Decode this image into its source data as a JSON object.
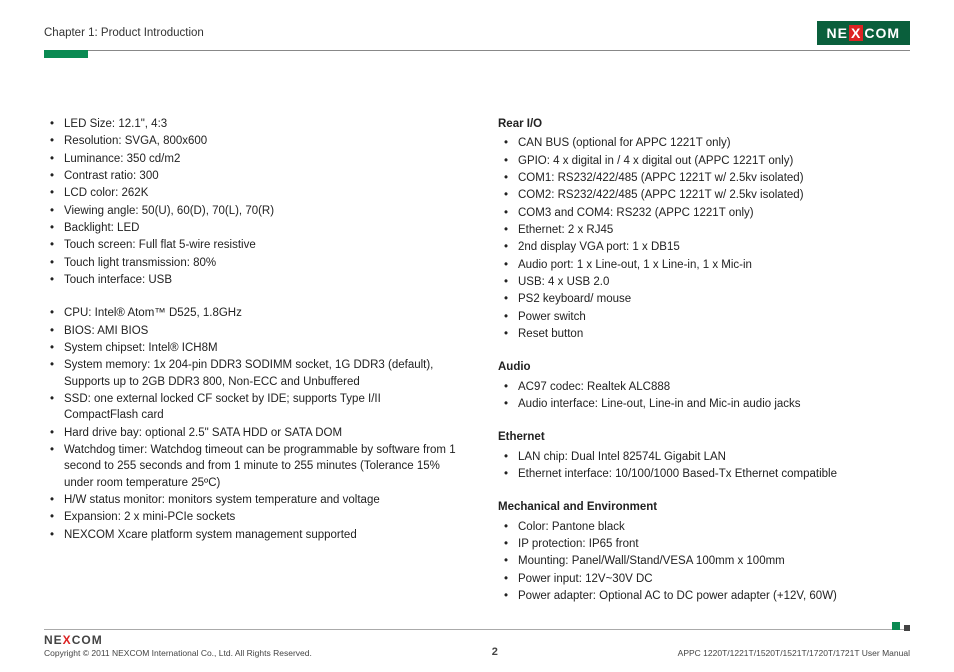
{
  "header": {
    "chapter": "Chapter 1: Product Introduction",
    "brand": "NEXCOM"
  },
  "left": {
    "block1": [
      "LED Size: 12.1\", 4:3",
      "Resolution: SVGA, 800x600",
      "Luminance: 350 cd/m2",
      "Contrast ratio: 300",
      "LCD color: 262K",
      "Viewing angle: 50(U), 60(D), 70(L), 70(R)",
      "Backlight: LED",
      "Touch screen: Full flat 5-wire resistive",
      "Touch light transmission: 80%",
      "Touch interface: USB"
    ],
    "block2": [
      "CPU: Intel® Atom™ D525, 1.8GHz",
      "BIOS: AMI BIOS",
      "System chipset: Intel® ICH8M",
      "System memory: 1x 204-pin DDR3 SODIMM socket, 1G DDR3 (default), Supports up to 2GB DDR3 800, Non-ECC and Unbuffered",
      "SSD: one external locked CF socket by IDE; supports Type I/II CompactFlash card",
      "Hard drive bay: optional 2.5\" SATA HDD or SATA DOM",
      "Watchdog timer: Watchdog timeout can be programmable by software from 1 second to 255 seconds and from 1 minute to 255 minutes (Tolerance 15% under room temperature 25ºC)",
      "H/W status monitor: monitors system temperature and voltage",
      "Expansion: 2 x mini-PCIe sockets",
      "NEXCOM Xcare platform system management supported"
    ]
  },
  "right": {
    "rear_io_title": "Rear I/O",
    "rear_io": [
      "CAN BUS (optional for APPC 1221T only)",
      "GPIO: 4 x digital in / 4 x digital out (APPC 1221T only)",
      "COM1: RS232/422/485 (APPC 1221T w/ 2.5kv isolated)",
      "COM2: RS232/422/485 (APPC 1221T w/ 2.5kv isolated)",
      "COM3 and COM4: RS232 (APPC 1221T only)",
      "Ethernet: 2 x RJ45",
      "2nd display VGA port: 1 x DB15",
      "Audio port: 1 x Line-out, 1 x Line-in, 1 x Mic-in",
      "USB: 4 x USB 2.0",
      "PS2 keyboard/ mouse",
      "Power switch",
      "Reset button"
    ],
    "audio_title": "Audio",
    "audio": [
      "AC97 codec: Realtek ALC888",
      "Audio interface: Line-out, Line-in and Mic-in audio jacks"
    ],
    "ethernet_title": "Ethernet",
    "ethernet": [
      "LAN chip: Dual Intel 82574L Gigabit LAN",
      "Ethernet interface: 10/100/1000 Based-Tx Ethernet compatible"
    ],
    "mech_title": "Mechanical and Environment",
    "mech": [
      "Color: Pantone black",
      "IP protection: IP65 front",
      "Mounting: Panel/Wall/Stand/VESA 100mm x 100mm",
      "Power input: 12V~30V DC",
      "Power adapter: Optional AC to DC power adapter (+12V, 60W)"
    ]
  },
  "footer": {
    "copyright": "Copyright © 2011 NEXCOM International Co., Ltd. All Rights Reserved.",
    "page": "2",
    "manual": "APPC 1220T/1221T/1520T/1521T/1720T/1721T User Manual"
  }
}
